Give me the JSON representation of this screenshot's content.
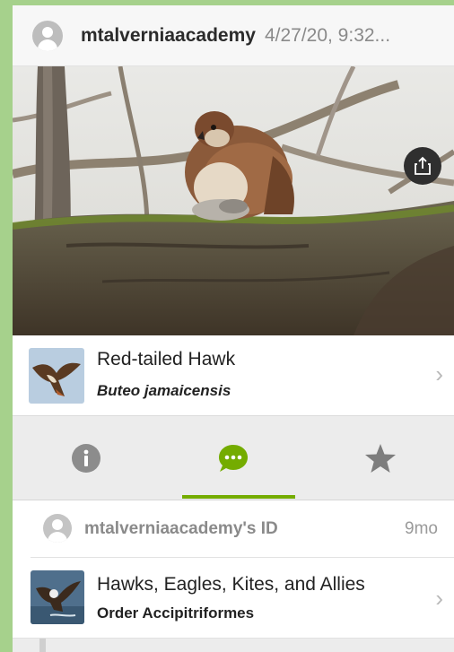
{
  "header": {
    "username": "mtalverniaacademy",
    "datetime": "4/27/20, 9:32..."
  },
  "photo": {
    "share_icon": "share-icon",
    "pager": {
      "count": 2,
      "active_index": 0
    }
  },
  "taxon": {
    "common_name": "Red-tailed Hawk",
    "scientific_name": "Buteo jamaicensis",
    "chevron": "›"
  },
  "tabs": [
    {
      "icon": "info-icon",
      "active": false
    },
    {
      "icon": "comments-icon",
      "active": true
    },
    {
      "icon": "star-icon",
      "active": false
    }
  ],
  "identification": {
    "user_label": "mtalverniaacademy's ID",
    "age": "9mo",
    "taxon_name": "Hawks, Eagles, Kites, and Allies",
    "rank_label": "Order Accipitriformes",
    "chevron": "›"
  },
  "colors": {
    "accent": "#74ac00",
    "background_border": "#a6d18c",
    "tab_bar": "#ececec"
  }
}
